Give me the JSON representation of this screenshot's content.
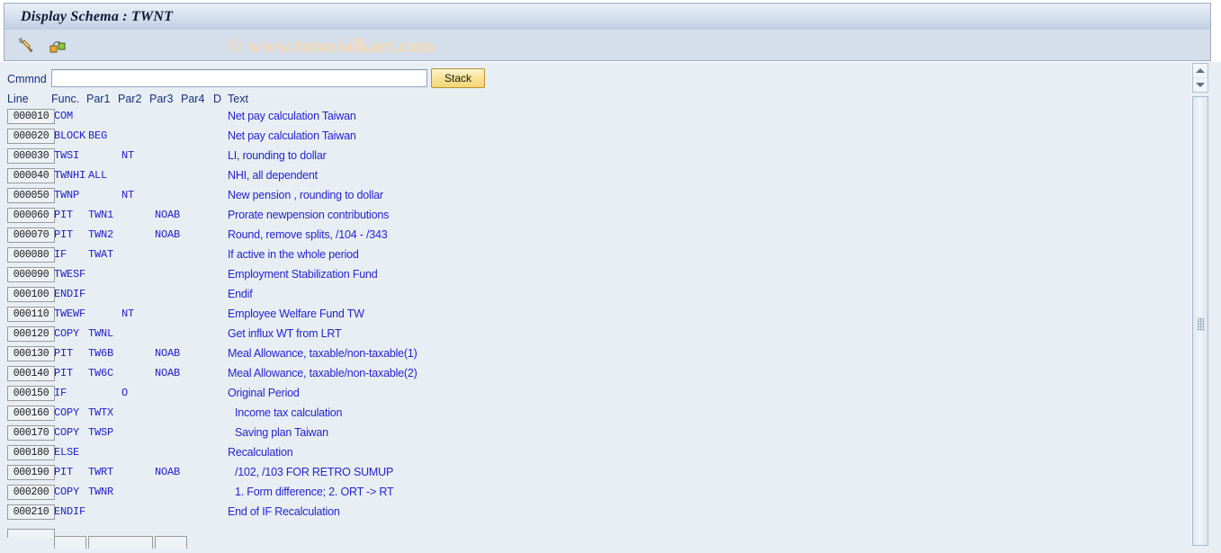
{
  "window": {
    "title": "Display Schema : TWNT"
  },
  "toolbar": {
    "icons": [
      {
        "name": "edit-pencil-icon",
        "title": "Change"
      },
      {
        "name": "structure-graph-icon",
        "title": "Structure graphic"
      }
    ]
  },
  "watermark": "© www.tutorialkart.com",
  "command": {
    "label": "Cmmnd",
    "value": "",
    "placeholder": "",
    "stack_label": "Stack"
  },
  "table": {
    "headers": {
      "line": "Line",
      "func": "Func.",
      "par1": "Par1",
      "par2": "Par2",
      "par3": "Par3",
      "par4": "Par4",
      "d": "D",
      "text": "Text"
    },
    "rows": [
      {
        "line": "000010",
        "func": "COM",
        "par1": "",
        "par2": "",
        "par3": "",
        "par4": "",
        "d": "",
        "text": "Net pay calculation Taiwan",
        "indent": false
      },
      {
        "line": "000020",
        "func": "BLOCK",
        "par1": "BEG",
        "par2": "",
        "par3": "",
        "par4": "",
        "d": "",
        "text": "Net pay calculation Taiwan",
        "indent": false
      },
      {
        "line": "000030",
        "func": "TWSI",
        "par1": "",
        "par2": "NT",
        "par3": "",
        "par4": "",
        "d": "",
        "text": "LI, rounding to dollar",
        "indent": false
      },
      {
        "line": "000040",
        "func": "TWNHI",
        "par1": "ALL",
        "par2": "",
        "par3": "",
        "par4": "",
        "d": "",
        "text": "NHI, all dependent",
        "indent": false
      },
      {
        "line": "000050",
        "func": "TWNP",
        "par1": "",
        "par2": "NT",
        "par3": "",
        "par4": "",
        "d": "",
        "text": "New pension , rounding to dollar",
        "indent": false
      },
      {
        "line": "000060",
        "func": "PIT",
        "par1": "TWN1",
        "par2": "",
        "par3": "NOAB",
        "par4": "",
        "d": "",
        "text": "Prorate newpension contributions",
        "indent": false
      },
      {
        "line": "000070",
        "func": "PIT",
        "par1": "TWN2",
        "par2": "",
        "par3": "NOAB",
        "par4": "",
        "d": "",
        "text": "Round, remove splits,  /104 - /343",
        "indent": false
      },
      {
        "line": "000080",
        "func": "IF",
        "par1": "TWAT",
        "par2": "",
        "par3": "",
        "par4": "",
        "d": "",
        "text": "If active in the whole period",
        "indent": false
      },
      {
        "line": "000090",
        "func": "TWESF",
        "par1": "",
        "par2": "",
        "par3": "",
        "par4": "",
        "d": "",
        "text": "Employment Stabilization Fund",
        "indent": false
      },
      {
        "line": "000100",
        "func": "ENDIF",
        "par1": "",
        "par2": "",
        "par3": "",
        "par4": "",
        "d": "",
        "text": "Endif",
        "indent": false
      },
      {
        "line": "000110",
        "func": "TWEWF",
        "par1": "",
        "par2": "NT",
        "par3": "",
        "par4": "",
        "d": "",
        "text": "Employee Welfare Fund TW",
        "indent": false
      },
      {
        "line": "000120",
        "func": "COPY",
        "par1": "TWNL",
        "par2": "",
        "par3": "",
        "par4": "",
        "d": "",
        "text": "Get influx WT from LRT",
        "indent": false
      },
      {
        "line": "000130",
        "func": "PIT",
        "par1": "TW6B",
        "par2": "",
        "par3": "NOAB",
        "par4": "",
        "d": "",
        "text": "Meal Allowance, taxable/non-taxable(1)",
        "indent": false
      },
      {
        "line": "000140",
        "func": "PIT",
        "par1": "TW6C",
        "par2": "",
        "par3": "NOAB",
        "par4": "",
        "d": "",
        "text": "Meal Allowance, taxable/non-taxable(2)",
        "indent": false
      },
      {
        "line": "000150",
        "func": "IF",
        "par1": "",
        "par2": "O",
        "par3": "",
        "par4": "",
        "d": "",
        "text": "Original Period",
        "indent": false
      },
      {
        "line": "000160",
        "func": "COPY",
        "par1": "TWTX",
        "par2": "",
        "par3": "",
        "par4": "",
        "d": "",
        "text": "Income tax calculation",
        "indent": true
      },
      {
        "line": "000170",
        "func": "COPY",
        "par1": "TWSP",
        "par2": "",
        "par3": "",
        "par4": "",
        "d": "",
        "text": "Saving plan Taiwan",
        "indent": true
      },
      {
        "line": "000180",
        "func": "ELSE",
        "par1": "",
        "par2": "",
        "par3": "",
        "par4": "",
        "d": "",
        "text": "Recalculation",
        "indent": false
      },
      {
        "line": "000190",
        "func": "PIT",
        "par1": "TWRT",
        "par2": "",
        "par3": "NOAB",
        "par4": "",
        "d": "",
        "text": "/102, /103 FOR RETRO SUMUP",
        "indent": true
      },
      {
        "line": "000200",
        "func": "COPY",
        "par1": "TWNR",
        "par2": "",
        "par3": "",
        "par4": "",
        "d": "",
        "text": "1. Form difference; 2. ORT -> RT",
        "indent": true
      },
      {
        "line": "000210",
        "func": "ENDIF",
        "par1": "",
        "par2": "",
        "par3": "",
        "par4": "",
        "d": "",
        "text": "End of IF Recalculation",
        "indent": false
      }
    ]
  },
  "scroll": {
    "up_label": "▲",
    "down_label": "▼"
  }
}
